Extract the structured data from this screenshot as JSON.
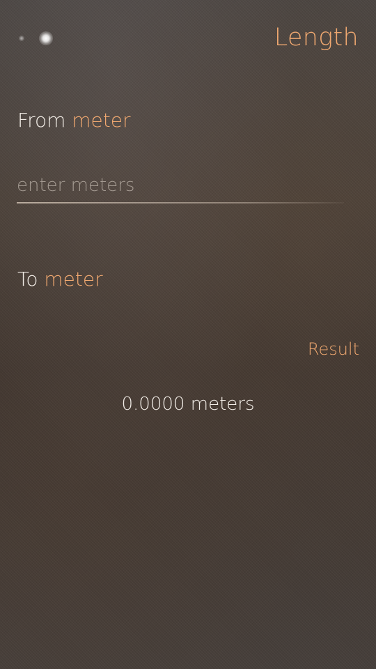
{
  "header": {
    "title": "Length",
    "pager": {
      "pages": 2,
      "active_index": 1
    }
  },
  "from": {
    "label": "From",
    "unit": "meter",
    "input_value": "",
    "input_placeholder": "enter meters"
  },
  "to": {
    "label": "To",
    "unit": "meter"
  },
  "result": {
    "label": "Result",
    "value": "0.0000 meters"
  },
  "colors": {
    "accent": "#f0a870",
    "text": "#f1ece6",
    "background": "#433a34"
  }
}
